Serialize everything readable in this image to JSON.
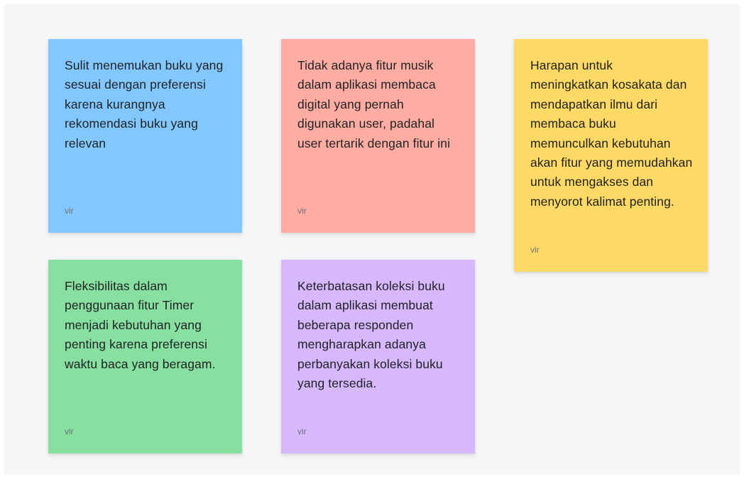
{
  "notes": [
    {
      "text": "Sulit menemukan buku yang sesuai dengan preferensi karena kurangnya rekomendasi buku yang relevan",
      "author": "vir",
      "color": "#82c8ff"
    },
    {
      "text": "Tidak adanya fitur musik dalam aplikasi membaca digital yang pernah digunakan user, padahal user tertarik dengan fitur ini",
      "author": "vir",
      "color": "#ffada2"
    },
    {
      "text": "Harapan untuk meningkatkan kosakata dan mendapatkan ilmu dari membaca buku memunculkan kebutuhan akan fitur yang memudahkan untuk mengakses dan menyorot kalimat penting.",
      "author": "vir",
      "color": "#ffd966"
    },
    {
      "text": "Fleksibilitas dalam penggunaan fitur Timer menjadi kebutuhan yang penting karena preferensi waktu baca yang beragam.",
      "author": "vir",
      "color": "#87e0a0"
    },
    {
      "text": "Keterbatasan koleksi buku dalam aplikasi membuat beberapa responden mengharapkan adanya perbanyakan koleksi buku yang tersedia.",
      "author": "vir",
      "color": "#d7b8ff"
    }
  ]
}
